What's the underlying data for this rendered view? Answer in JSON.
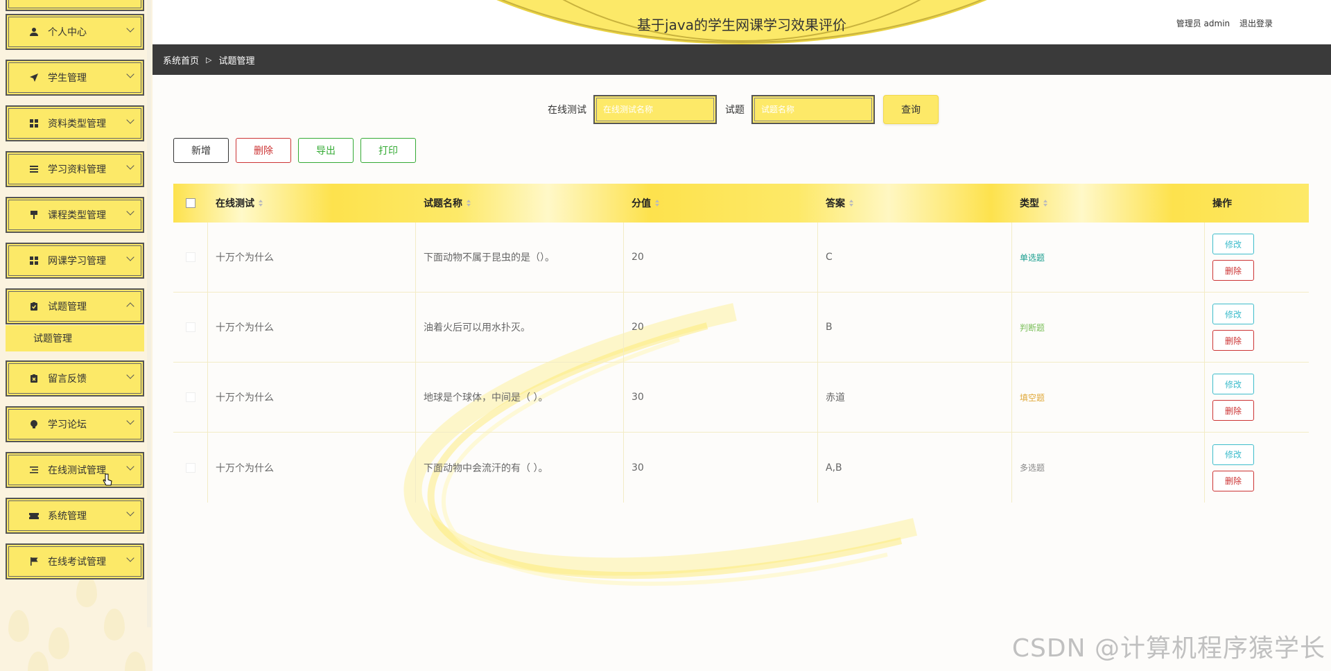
{
  "header": {
    "title": "基于java的学生网课学习效果评价",
    "role": "管理员 admin",
    "logout": "退出登录"
  },
  "breadcrumb": {
    "home": "系统首页",
    "separator": "▷",
    "current": "试题管理"
  },
  "sidebar": {
    "items": [
      {
        "label": "个人中心",
        "icon": "user-icon"
      },
      {
        "label": "学生管理",
        "icon": "paper-plane-icon"
      },
      {
        "label": "资料类型管理",
        "icon": "grid-icon"
      },
      {
        "label": "学习资料管理",
        "icon": "list-icon"
      },
      {
        "label": "课程类型管理",
        "icon": "brush-icon"
      },
      {
        "label": "网课学习管理",
        "icon": "grid-icon"
      },
      {
        "label": "试题管理",
        "icon": "clipboard-check-icon"
      },
      {
        "label": "留言反馈",
        "icon": "clipboard-x-icon"
      },
      {
        "label": "学习论坛",
        "icon": "bulb-icon"
      },
      {
        "label": "在线测试管理",
        "icon": "list-indent-icon"
      },
      {
        "label": "系统管理",
        "icon": "ticket-icon"
      },
      {
        "label": "在线考试管理",
        "icon": "flag-icon"
      }
    ],
    "submenu": "试题管理"
  },
  "search": {
    "label1": "在线测试",
    "placeholder1": "在线测试名称",
    "label2": "试题",
    "placeholder2": "试题名称",
    "button": "查询"
  },
  "actions": {
    "add": "新增",
    "delete": "删除",
    "export": "导出",
    "print": "打印"
  },
  "table": {
    "headers": [
      "在线测试",
      "试题名称",
      "分值",
      "答案",
      "类型",
      "操作"
    ],
    "rows": [
      {
        "test": "十万个为什么",
        "question": "下面动物不属于昆虫的是（）。",
        "score": "20",
        "answer": "C",
        "type": "单选题",
        "type_color": "#1a9e8f"
      },
      {
        "test": "十万个为什么",
        "question": "油着火后可以用水扑灭。",
        "score": "20",
        "answer": "B",
        "type": "判断题",
        "type_color": "#7bbf5a"
      },
      {
        "test": "十万个为什么",
        "question": "地球是个球体，中间是（ ）。",
        "score": "30",
        "answer": "赤道",
        "type": "填空题",
        "type_color": "#e0a93a"
      },
      {
        "test": "十万个为什么",
        "question": "下面动物中会流汗的有（ ）。",
        "score": "30",
        "answer": "A,B",
        "type": "多选题",
        "type_color": "#888888"
      }
    ],
    "edit_label": "修改",
    "delete_label": "删除"
  },
  "watermark": "CSDN @计算机程序猿学长"
}
